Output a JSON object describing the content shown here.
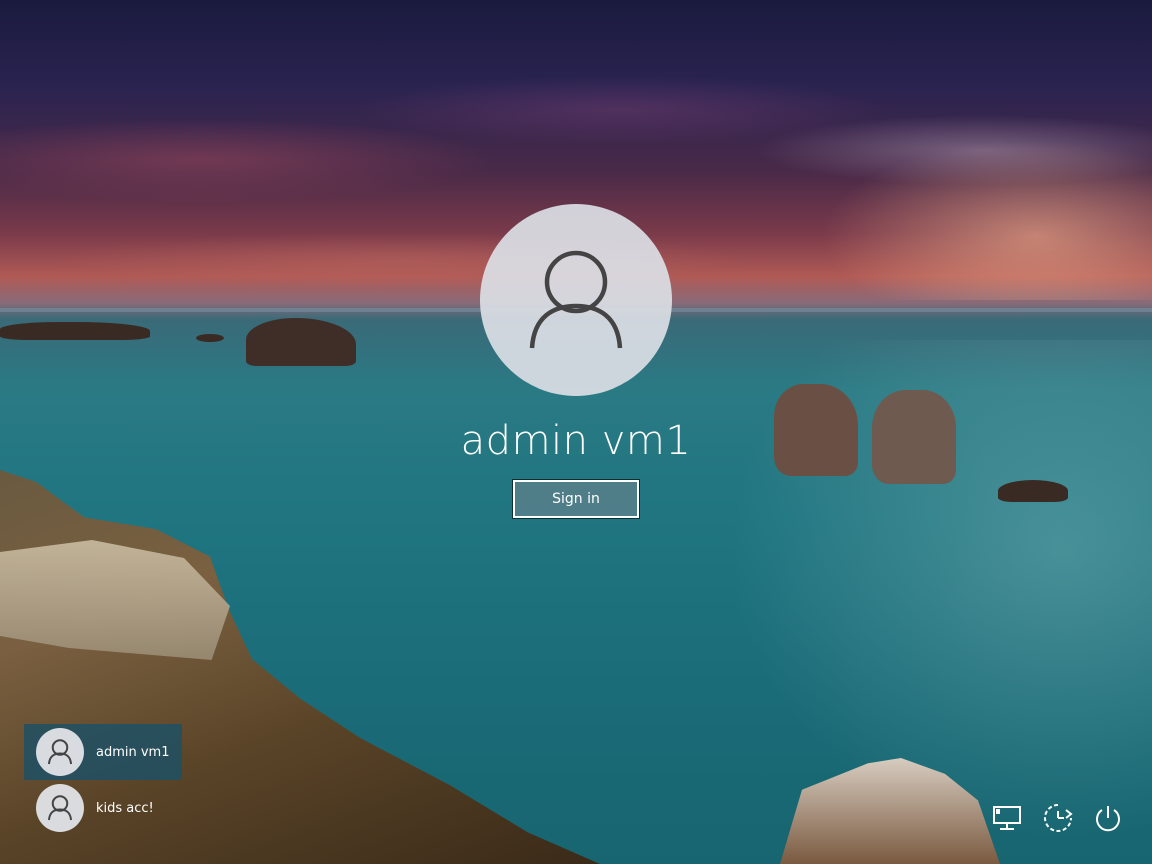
{
  "lock_screen": {
    "selected_user": {
      "name": "admin vm1",
      "avatar_icon": "user-silhouette-icon"
    },
    "sign_in_label": "Sign in"
  },
  "user_list": {
    "items": [
      {
        "name": "admin vm1",
        "selected": true,
        "icon": "user-silhouette-icon"
      },
      {
        "name": "kids acc!",
        "selected": false,
        "icon": "user-silhouette-icon"
      }
    ]
  },
  "tray": {
    "icons": [
      "network-icon",
      "ease-of-access-icon",
      "power-icon"
    ]
  },
  "colors": {
    "text": "#ffffff",
    "avatar_bg": "#dadee4",
    "selected_user_bg": "#1e5064"
  }
}
